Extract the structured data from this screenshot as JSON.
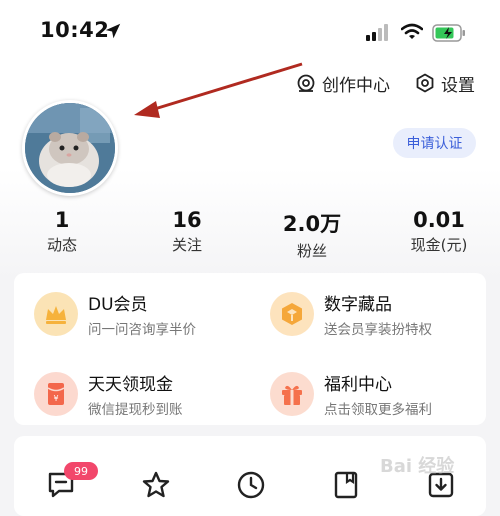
{
  "status_bar": {
    "time": "10:42"
  },
  "header": {
    "creator_center": "创作中心",
    "settings": "设置",
    "verify_button": "申请认证"
  },
  "stats": [
    {
      "value": "1",
      "label": "动态"
    },
    {
      "value": "16",
      "label": "关注"
    },
    {
      "value": "2.0万",
      "label": "粉丝"
    },
    {
      "value": "0.01",
      "label": "现金(元)"
    }
  ],
  "services": [
    {
      "title": "DU会员",
      "subtitle": "问一问咨询享半价",
      "icon": "crown-icon",
      "color": "#f6b23c"
    },
    {
      "title": "数字藏品",
      "subtitle": "送会员享装扮特权",
      "icon": "cube-icon",
      "color": "#f5a73a"
    },
    {
      "title": "天天领现金",
      "subtitle": "微信提现秒到账",
      "icon": "red-envelope-icon",
      "color": "#f3674b"
    },
    {
      "title": "福利中心",
      "subtitle": "点击领取更多福利",
      "icon": "gift-icon",
      "color": "#f5714c"
    }
  ],
  "bottom_icons": {
    "message_badge": "99",
    "icons": [
      "message-icon",
      "star-icon",
      "clock-icon",
      "bookmark-icon",
      "download-icon"
    ]
  },
  "watermark": "Bai 经验"
}
